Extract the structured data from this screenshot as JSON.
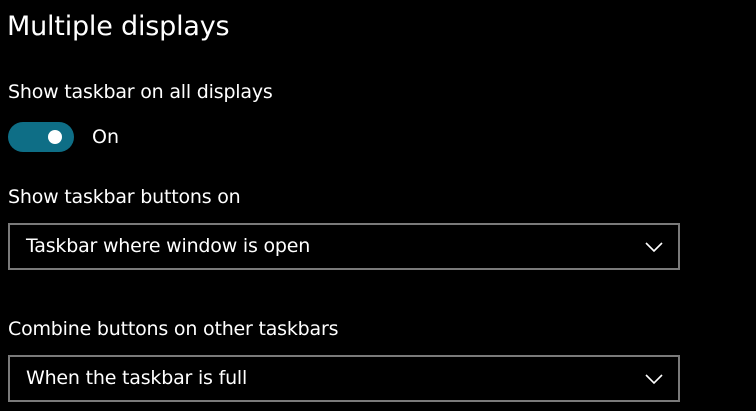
{
  "section": {
    "title": "Multiple displays"
  },
  "show_taskbar_all": {
    "label": "Show taskbar on all displays",
    "toggle_state": "On",
    "toggle_on": true,
    "accent_color": "#0e6e86"
  },
  "taskbar_buttons_on": {
    "label": "Show taskbar buttons on",
    "selected": "Taskbar where window is open",
    "icon": "chevron-down-icon"
  },
  "combine_buttons_other": {
    "label": "Combine buttons on other taskbars",
    "selected": "When the taskbar is full",
    "icon": "chevron-down-icon"
  }
}
